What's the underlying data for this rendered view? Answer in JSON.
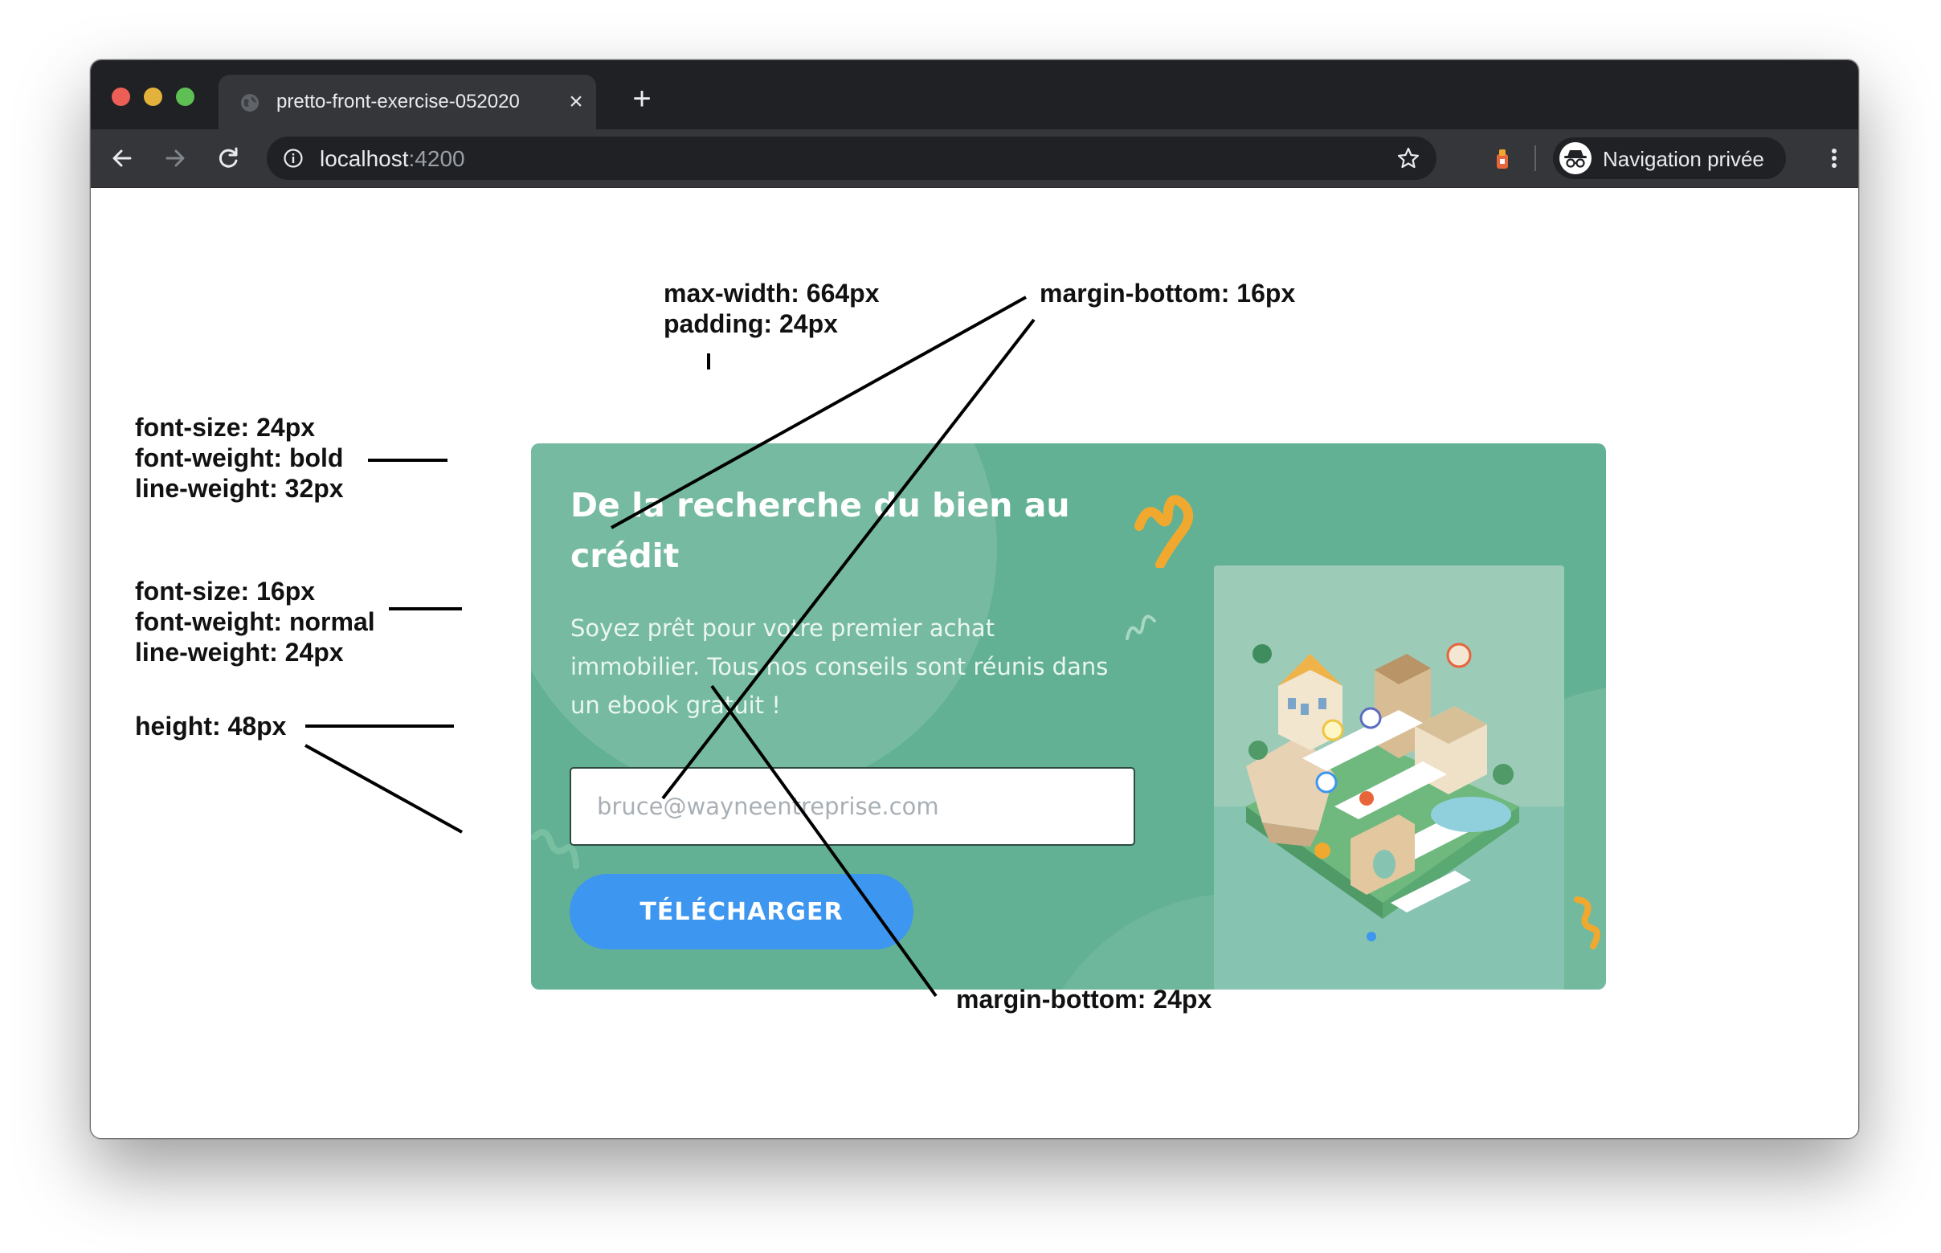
{
  "browser": {
    "tab_title": "pretto-front-exercise-052020",
    "tab_close_icon": "×",
    "new_tab_icon": "+",
    "url_host": "localhost",
    "url_port": ":4200",
    "profile_label": "Navigation privée"
  },
  "card": {
    "title": "De la recherche du bien au crédit",
    "description": "Soyez prêt pour votre premier achat immobilier. Tous nos conseils sont réunis dans un ebook gratuit !",
    "email_placeholder": "bruce@wayneentreprise.com",
    "button_label": "TÉLÉCHARGER",
    "colors": {
      "card_bg": "#62b194",
      "button_bg": "#3d96ef",
      "accent_squiggle": "#f0a92e"
    }
  },
  "annotations": {
    "container": [
      "max-width: 664px",
      "padding: 24px"
    ],
    "title": [
      "font-size:  24px",
      "font-weight: bold",
      "line-weight: 32px"
    ],
    "text": [
      "font-size:  16px",
      "font-weight: normal",
      "line-weight: 24px"
    ],
    "height": "height: 48px",
    "margin_16": "margin-bottom: 16px",
    "margin_24": "margin-bottom: 24px"
  },
  "icons": [
    "back-arrow-icon",
    "forward-arrow-icon",
    "reload-icon",
    "info-icon",
    "star-icon",
    "extension-icon",
    "incognito-icon",
    "more-menu-icon",
    "globe-icon"
  ]
}
